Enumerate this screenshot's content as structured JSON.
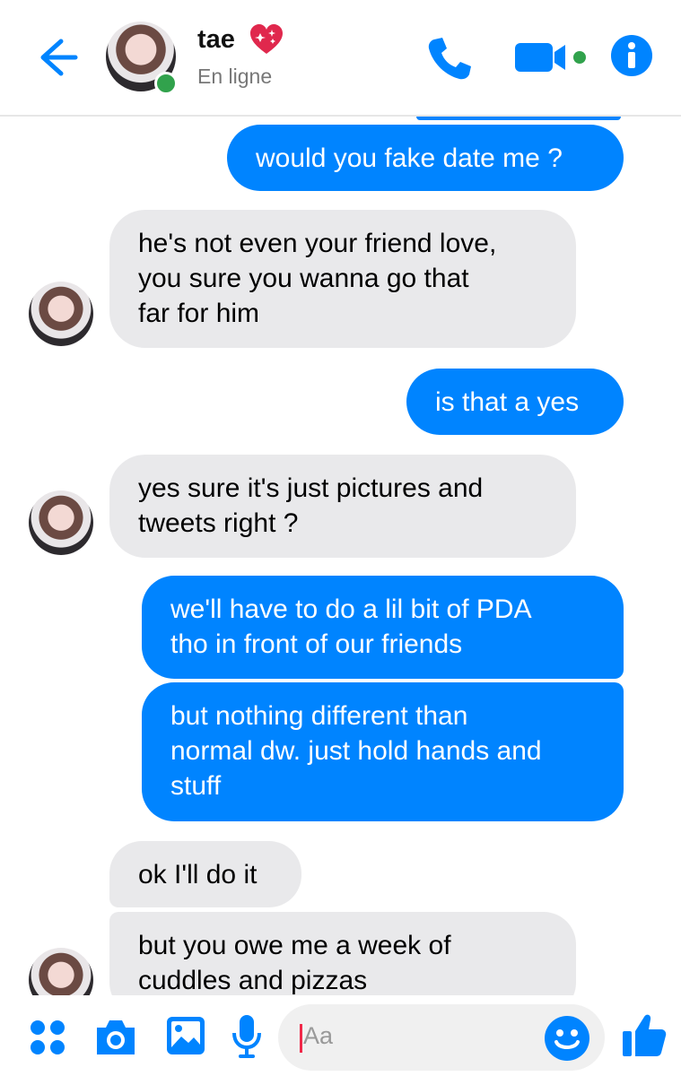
{
  "header": {
    "contact_name": "tae",
    "status": "En ligne"
  },
  "messages": [
    {
      "direction": "out",
      "text": "would you fake date me ?"
    },
    {
      "direction": "in",
      "text": "he's not even your friend love,\nyou sure you wanna go that\nfar for him"
    },
    {
      "direction": "out",
      "text": "is that a yes"
    },
    {
      "direction": "in",
      "text": "yes sure it's just pictures and\ntweets right ?"
    },
    {
      "direction": "out",
      "text": "we'll have to do a lil bit of PDA\ntho in front of our friends"
    },
    {
      "direction": "out",
      "text": "but nothing different than\nnormal dw. just hold hands and\nstuff"
    },
    {
      "direction": "in",
      "text": "ok I'll do it"
    },
    {
      "direction": "in",
      "text": "but you owe me a week of\ncuddles and pizzas"
    }
  ],
  "composer": {
    "placeholder": "Aa"
  },
  "colors": {
    "accent": "#0084ff",
    "incoming_bubble": "#e9e9eb",
    "online": "#31a24c"
  },
  "icons": {
    "back": "arrow-left-icon",
    "call": "phone-icon",
    "video": "video-camera-icon",
    "info": "info-icon",
    "apps": "four-dots-icon",
    "camera": "camera-icon",
    "gallery": "image-icon",
    "voice": "microphone-icon",
    "emoji": "smiley-icon",
    "like": "thumbs-up-icon"
  }
}
